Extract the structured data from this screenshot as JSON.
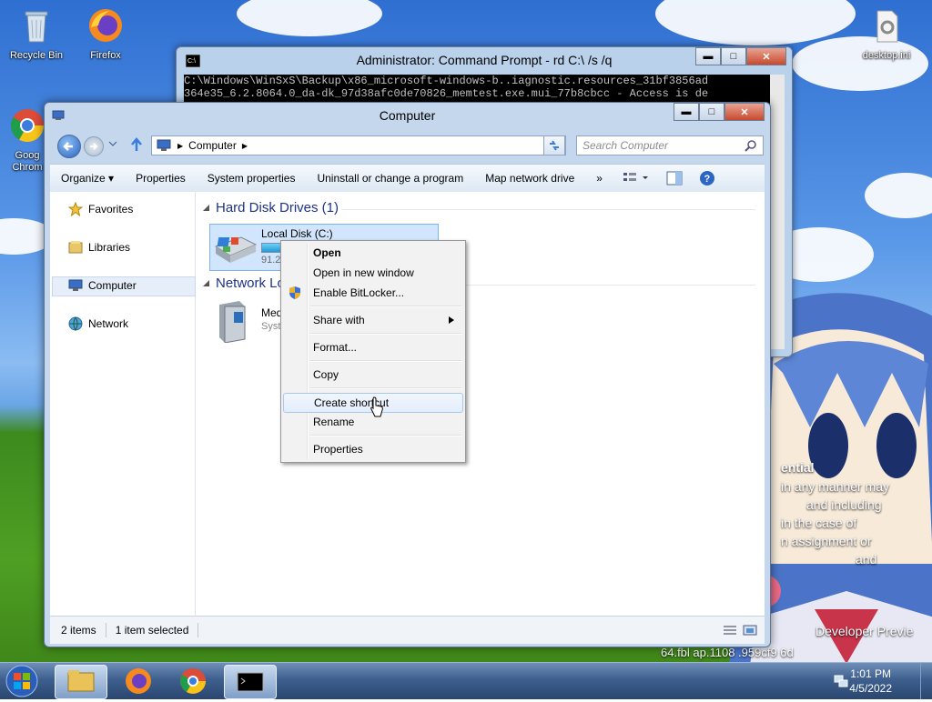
{
  "desktop": {
    "icons": [
      {
        "label": "Recycle Bin"
      },
      {
        "label": "Firefox"
      },
      {
        "label": "desktop.ini"
      },
      {
        "label": "Goog Chrom"
      }
    ],
    "overlay_text": {
      "heading": "ential",
      "lines": [
        "in any manner may",
        "and including",
        "in the case of",
        "n assignment or",
        "and"
      ],
      "footer1": "Developer Previe",
      "footer2": "64.fbl ap.1108 .959cf9 6d"
    }
  },
  "cmd_window": {
    "title": "Administrator: Command Prompt - rd  C:\\ /s /q",
    "lines": [
      "C:\\Windows\\WinSxS\\Backup\\x86_microsoft-windows-b..iagnostic.resources_31bf3856ad",
      "364e35_6.2.8064.0_da-dk_97d38afc0de70826_memtest.exe.mui_77b8cbcc - Access is de"
    ],
    "caption": {
      "min": "▬",
      "max": "□",
      "close": "✕"
    }
  },
  "explorer": {
    "title": "Computer",
    "address": {
      "root": "Computer",
      "path": "Computer"
    },
    "search_placeholder": "Search Computer",
    "toolbar": [
      {
        "label": "Organize ▾"
      },
      {
        "label": "Properties"
      },
      {
        "label": "System properties"
      },
      {
        "label": "Uninstall or change a program"
      },
      {
        "label": "Map network drive"
      },
      {
        "label": "»"
      }
    ],
    "nav": [
      {
        "label": "Favorites"
      },
      {
        "label": "Libraries"
      },
      {
        "label": "Computer"
      },
      {
        "label": "Network"
      }
    ],
    "groups": {
      "hdd": "Hard Disk Drives (1)",
      "network": "Network Lo"
    },
    "drive": {
      "name": "Local Disk (C:)",
      "free_text": "91.2",
      "used_fraction": 0.12
    },
    "media": {
      "name": "Med",
      "sub": "Syst"
    },
    "status": {
      "items": "2 items",
      "selected": "1 item selected"
    }
  },
  "context_menu": {
    "items": [
      {
        "label": "Open",
        "bold": true
      },
      {
        "label": "Open in new window"
      },
      {
        "label": "Enable BitLocker..."
      },
      {
        "label": "Share with"
      },
      {
        "label": "Format..."
      },
      {
        "label": "Copy"
      },
      {
        "label": "Create shortcut"
      },
      {
        "label": "Rename"
      },
      {
        "label": "Properties"
      }
    ]
  },
  "taskbar": {
    "time": "1:01 PM",
    "date": "4/5/2022"
  }
}
